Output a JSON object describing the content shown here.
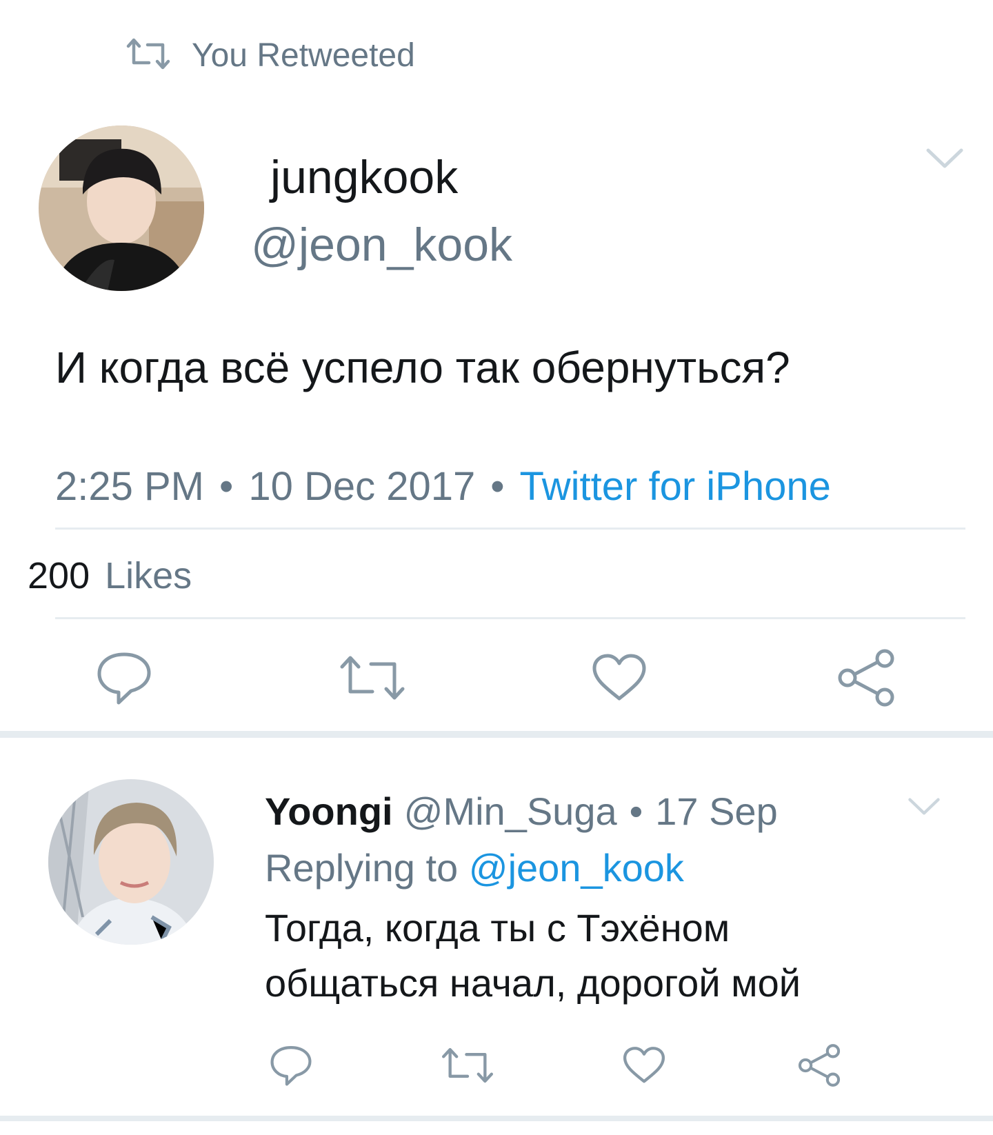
{
  "retweet_header": {
    "label": "You Retweeted",
    "icon": "retweet-icon"
  },
  "tweet": {
    "display_name": "jungkook",
    "handle": "@jeon_kook",
    "text": "И когда всё успело так обернуться?",
    "time": "2:25 PM",
    "date": "10 Dec 2017",
    "separator": "•",
    "source": "Twitter for iPhone",
    "likes_count": "200",
    "likes_label": "Likes"
  },
  "reply": {
    "display_name": "Yoongi",
    "handle": "@Min_Suga",
    "separator": "•",
    "date": "17 Sep",
    "replying_prefix": "Replying to",
    "replying_to": "@jeon_kook",
    "text_line1": "Тогда, когда ты с Тэхёном",
    "text_line2": "общаться начал, дорогой мой"
  },
  "colors": {
    "accent": "#1b95e0",
    "secondary_text": "#657786",
    "primary_text": "#14171a",
    "divider": "#e6ecf0"
  }
}
